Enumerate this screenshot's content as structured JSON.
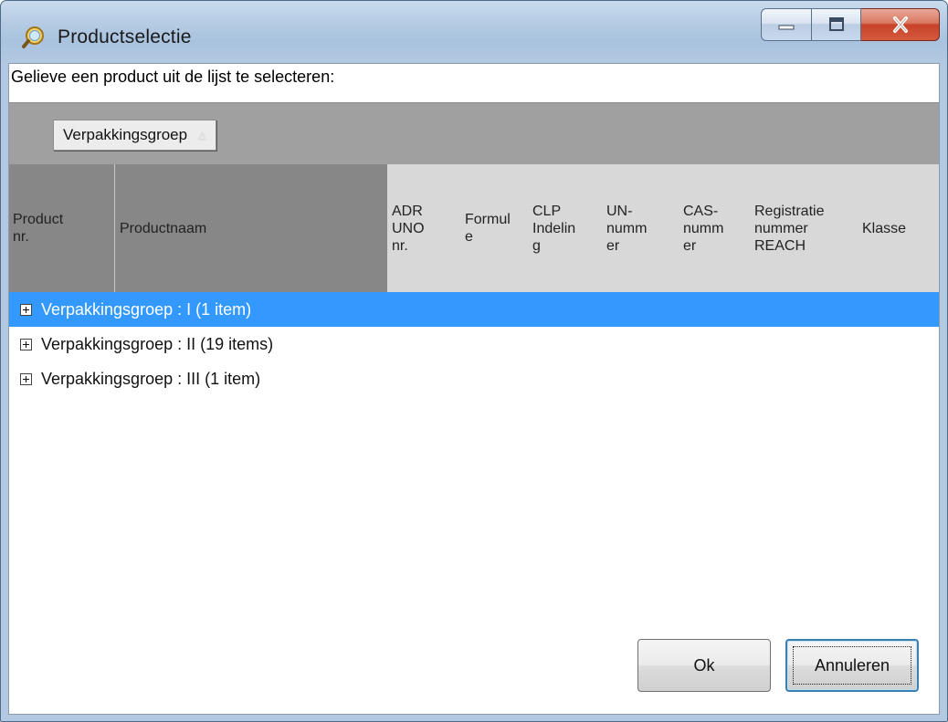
{
  "window": {
    "title": "Productselectie",
    "icon": "search-magnifier-icon"
  },
  "caption": {
    "minimize_icon": "minimize-icon",
    "maximize_icon": "maximize-icon",
    "close_icon": "close-icon"
  },
  "prompt": "Gelieve een product uit de lijst te selecteren:",
  "group_panel": {
    "chip_label": "Verpakkingsgroep",
    "sort": "ascending"
  },
  "columns": [
    {
      "l1": "Product",
      "l2": "nr.",
      "l3": ""
    },
    {
      "l1": "Productnaam",
      "l2": "",
      "l3": ""
    },
    {
      "l1": "ADR",
      "l2": "UNO",
      "l3": "nr."
    },
    {
      "l1": "Formul",
      "l2": "e",
      "l3": ""
    },
    {
      "l1": "CLP",
      "l2": "Indelin",
      "l3": "g"
    },
    {
      "l1": "UN-",
      "l2": "numm",
      "l3": "er"
    },
    {
      "l1": "CAS-",
      "l2": "numm",
      "l3": "er"
    },
    {
      "l1": "Registratie",
      "l2": "nummer",
      "l3": "REACH"
    },
    {
      "l1": "Klasse",
      "l2": "",
      "l3": ""
    }
  ],
  "groups": [
    {
      "label": "Verpakkingsgroep : I (1 item)",
      "selected": true
    },
    {
      "label": "Verpakkingsgroep : II (19 items)",
      "selected": false
    },
    {
      "label": "Verpakkingsgroep : III (1 item)",
      "selected": false
    }
  ],
  "buttons": {
    "ok": "Ok",
    "cancel": "Annuleren"
  },
  "colors": {
    "selection": "#3399ff",
    "group_panel": "#a0a0a0",
    "header": "#d8d8d8",
    "header_sorted": "#878787"
  }
}
